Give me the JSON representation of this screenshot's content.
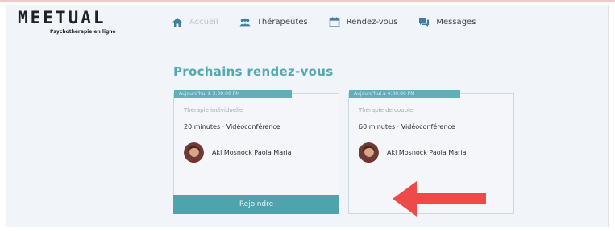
{
  "brand": {
    "name": "MEETUAL",
    "tagline": "Psychothérapie en ligne"
  },
  "nav": {
    "items": [
      {
        "label": "Accueil",
        "icon": "home-icon",
        "active": true
      },
      {
        "label": "Thérapeutes",
        "icon": "people-icon",
        "active": false
      },
      {
        "label": "Rendez-vous",
        "icon": "calendar-icon",
        "active": false
      },
      {
        "label": "Messages",
        "icon": "chat-icon",
        "active": false
      }
    ]
  },
  "main": {
    "title": "Prochains rendez-vous",
    "appointments": [
      {
        "date": "Aujourd'hui à 3:00:00 PM",
        "type": "Thérapie individuelle",
        "details": "20 minutes · Vidéoconférence",
        "therapist": "Akl Mosnock Paola Maria",
        "action_label": "Rejoindre"
      },
      {
        "date": "Aujourd'hui à 4:00:00 PM",
        "type": "Thérapie de couple",
        "details": "60 minutes · Vidéoconférence",
        "therapist": "Akl Mosnock Paola Maria"
      }
    ]
  },
  "colors": {
    "accent": "#55a9b2",
    "button": "#4fa3ad",
    "arrow": "#ee4a4a",
    "background": "#f1f4f8"
  }
}
